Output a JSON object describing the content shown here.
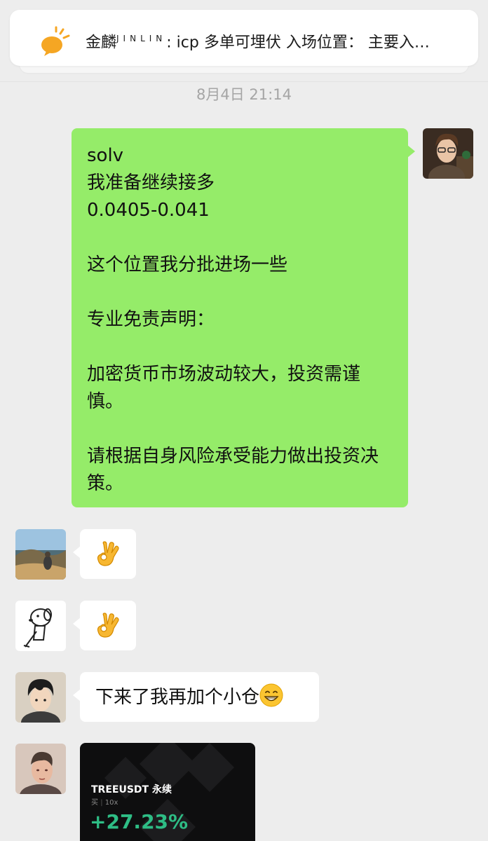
{
  "notice": {
    "sender": "金麟",
    "sender_tag": "JINLIN",
    "text": ": icp 多单可埋伏 入场位置：  主要入…"
  },
  "timestamp": "8月4日 21:14",
  "messages": {
    "own": {
      "text": "solv\n我准备继续接多\n0.0405-0.041\n\n这个位置我分批进场一些\n\n专业免责声明：\n\n加密货币市场波动较大，投资需谨慎。\n\n请根据自身风险承受能力做出投资决策。"
    },
    "reply3": {
      "text": "下来了我再加个小仓"
    },
    "card": {
      "pair": "TREEUSDT 永续",
      "side": "买",
      "leverage": "10x",
      "pnl": "+27.23%"
    }
  },
  "colors": {
    "own_bubble": "#95ec69",
    "other_bubble": "#ffffff",
    "background": "#ededed",
    "pnl_green": "#2ebd85"
  }
}
